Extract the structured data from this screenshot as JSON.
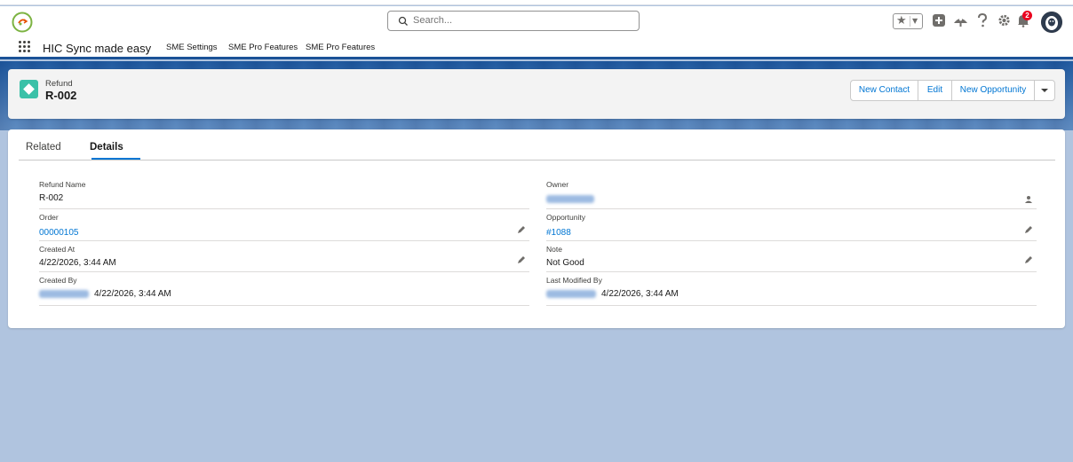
{
  "header": {
    "search_placeholder": "Search...",
    "notification_count": "2"
  },
  "context": {
    "app_name": "HIC Sync made easy",
    "nav": [
      "SME Settings",
      "SME Pro Features",
      "SME Pro Features"
    ]
  },
  "record": {
    "object_type": "Refund",
    "name": "R-002",
    "actions": [
      "New Contact",
      "Edit",
      "New Opportunity"
    ]
  },
  "tabs": [
    "Related",
    "Details"
  ],
  "active_tab": "Details",
  "fields": {
    "refund_name": {
      "label": "Refund Name",
      "value": "R-002"
    },
    "owner": {
      "label": "Owner",
      "value": ""
    },
    "order": {
      "label": "Order",
      "value": "00000105"
    },
    "opportunity": {
      "label": "Opportunity",
      "value": "#1088"
    },
    "created_at": {
      "label": "Created At",
      "value": "4/22/2026, 3:44 AM"
    },
    "note": {
      "label": "Note",
      "value": "Not Good"
    },
    "created_by": {
      "label": "Created By",
      "value": "4/22/2026, 3:44 AM"
    },
    "last_modified_by": {
      "label": "Last Modified By",
      "value": "4/22/2026, 3:44 AM"
    }
  },
  "colors": {
    "brand": "#0176d3",
    "banner": "#1b5297",
    "page_bg": "#b0c4df",
    "object_icon": "#3bc1a8",
    "badge": "#ea001e"
  }
}
